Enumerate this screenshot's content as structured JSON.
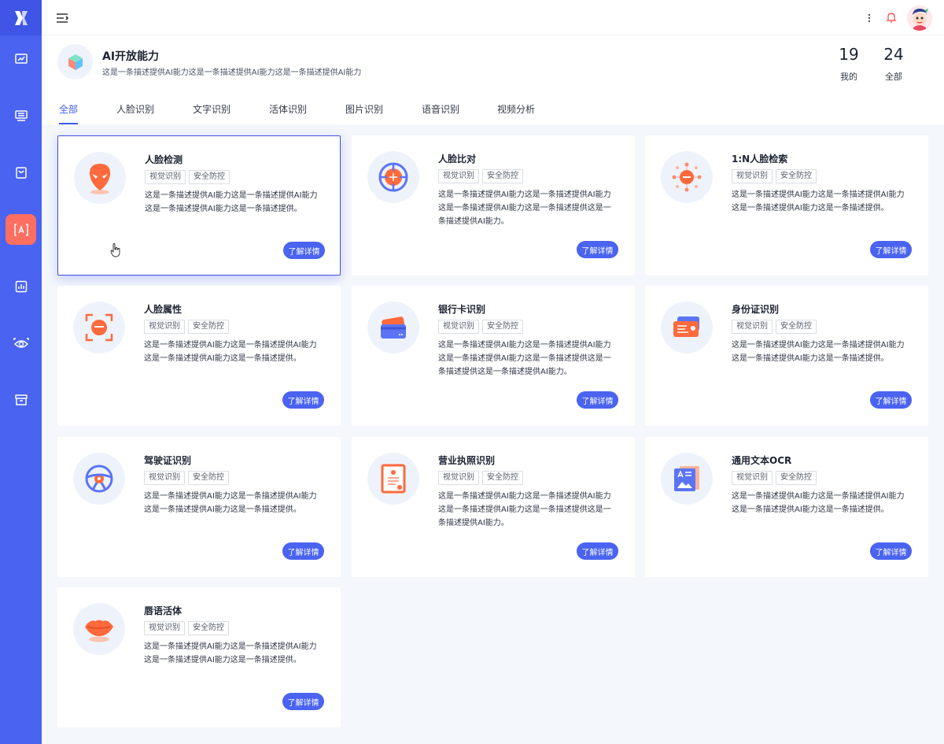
{
  "topbar": {
    "menu_icon": "menu-fold-icon",
    "more_icon": "more-vertical-icon",
    "bell_icon": "bell-icon",
    "avatar_icon": "avatar"
  },
  "sidebar": {
    "logo_icon": "logo-x-icon",
    "items": [
      {
        "icon": "dashboard-icon",
        "active": false
      },
      {
        "icon": "monitor-list-icon",
        "active": false
      },
      {
        "icon": "shopping-bag-icon",
        "active": false
      },
      {
        "icon": "ai-capability-icon",
        "active": true
      },
      {
        "icon": "report-chart-icon",
        "active": false
      },
      {
        "icon": "eye-scan-icon",
        "active": false
      },
      {
        "icon": "archive-box-icon",
        "active": false
      }
    ]
  },
  "header": {
    "title": "AI开放能力",
    "description": "这是一条描述提供AI能力这是一条描述提供AI能力这是一条描述提供AI能力",
    "stats": [
      {
        "num": "19",
        "label": "我的"
      },
      {
        "num": "24",
        "label": "全部"
      }
    ]
  },
  "tabs": [
    {
      "label": "全部",
      "active": true
    },
    {
      "label": "人脸识别",
      "active": false
    },
    {
      "label": "文字识别",
      "active": false
    },
    {
      "label": "活体识别",
      "active": false
    },
    {
      "label": "图片识别",
      "active": false
    },
    {
      "label": "语音识别",
      "active": false
    },
    {
      "label": "视频分析",
      "active": false
    }
  ],
  "colors": {
    "primary": "#4a63f0",
    "accent": "#ff6f61",
    "icon_orange": "#ff6a3d",
    "icon_blue": "#5b74f5"
  },
  "cards": [
    {
      "title": "人脸检测",
      "tags": [
        "视觉识别",
        "安全防控"
      ],
      "desc": "这是一条描述提供AI能力这是一条描述提供AI能力这是一条描述提供AI能力这是一条描述提供。",
      "button": "了解详情",
      "icon": "alien-face-icon",
      "selected": true
    },
    {
      "title": "人脸比对",
      "tags": [
        "视觉识别",
        "安全防控"
      ],
      "desc": "这是一条描述提供AI能力这是一条描述提供AI能力这是一条描述提供AI能力这是一条描述提供这是一条描述提供AI能力。",
      "button": "了解详情",
      "icon": "target-face-icon",
      "selected": false
    },
    {
      "title": "1:N人脸检索",
      "tags": [
        "视觉识别",
        "安全防控"
      ],
      "desc": "这是一条描述提供AI能力这是一条描述提供AI能力这是一条描述提供AI能力这是一条描述提供。",
      "button": "了解详情",
      "icon": "face-network-icon",
      "selected": false
    },
    {
      "title": "人脸属性",
      "tags": [
        "视觉识别",
        "安全防控"
      ],
      "desc": "这是一条描述提供AI能力这是一条描述提供AI能力这是一条描述提供AI能力这是一条描述提供。",
      "button": "了解详情",
      "icon": "face-frame-icon",
      "selected": false
    },
    {
      "title": "银行卡识别",
      "tags": [
        "视觉识别",
        "安全防控"
      ],
      "desc": "这是一条描述提供AI能力这是一条描述提供AI能力这是一条描述提供AI能力这是一条描述提供这是一条描述提供这是一条描述提供AI能力。",
      "button": "了解详情",
      "icon": "bank-card-icon",
      "selected": false
    },
    {
      "title": "身份证识别",
      "tags": [
        "视觉识别",
        "安全防控"
      ],
      "desc": "这是一条描述提供AI能力这是一条描述提供AI能力这是一条描述提供AI能力这是一条描述提供。",
      "button": "了解详情",
      "icon": "id-card-icon",
      "selected": false
    },
    {
      "title": "驾驶证识别",
      "tags": [
        "视觉识别",
        "安全防控"
      ],
      "desc": "这是一条描述提供AI能力这是一条描述提供AI能力这是一条描述提供AI能力这是一条描述提供。",
      "button": "了解详情",
      "icon": "steering-wheel-icon",
      "selected": false
    },
    {
      "title": "营业执照识别",
      "tags": [
        "视觉识别",
        "安全防控"
      ],
      "desc": "这是一条描述提供AI能力这是一条描述提供AI能力这是一条描述提供AI能力这是一条描述提供这是一条描述提供AI能力。",
      "button": "了解详情",
      "icon": "business-license-icon",
      "selected": false
    },
    {
      "title": "通用文本OCR",
      "tags": [
        "视觉识别",
        "安全防控"
      ],
      "desc": "这是一条描述提供AI能力这是一条描述提供AI能力这是一条描述提供AI能力这是一条描述提供。",
      "button": "了解详情",
      "icon": "text-ocr-icon",
      "selected": false
    },
    {
      "title": "唇语活体",
      "tags": [
        "视觉识别",
        "安全防控"
      ],
      "desc": "这是一条描述提供AI能力这是一条描述提供AI能力这是一条描述提供AI能力这是一条描述提供。",
      "button": "了解详情",
      "icon": "lips-icon",
      "selected": false
    }
  ]
}
